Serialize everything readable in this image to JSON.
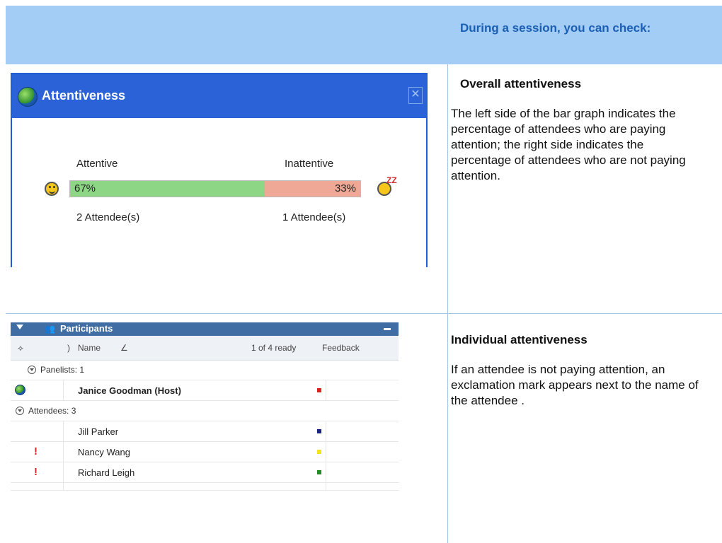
{
  "header": {
    "text": "During a session, you can check:"
  },
  "attentiveness_window": {
    "title": "Attentive­ness",
    "labels": {
      "attentive": "Attentive",
      "inattentive": "Inattentive"
    },
    "attentive_pct_text": "67%",
    "inattentive_pct_text": "33%",
    "attentive_fraction": 0.67,
    "attendees_attentive": "2 Attendee(s)",
    "attendees_inattentive": "1 Attendee(s)"
  },
  "overall": {
    "title": "Overall attentiveness",
    "body": "The left side of the bar graph indicates the percentage of attendees who are paying attention; the right side indicates the percentage of attendees who are not paying attention."
  },
  "participants_panel": {
    "title": "Participants",
    "columns": {
      "name": "Name",
      "ready": "1 of 4 ready",
      "feedback": "Feedback"
    },
    "groups": {
      "panelists": "Panelists: 1",
      "attendees": "Attendees: 3"
    },
    "host": {
      "name": "Janice Goodman (Host)",
      "color": "#e02020"
    },
    "attendees": [
      {
        "name": "Jill Parker",
        "color": "#1a237e",
        "inattentive": false
      },
      {
        "name": "Nancy Wang",
        "color": "#f3e31b",
        "inattentive": true
      },
      {
        "name": "Richard Leigh",
        "color": "#1e8a2a",
        "inattentive": true
      }
    ],
    "exclamation": "!"
  },
  "individual": {
    "title": "Individual attentiveness",
    "body": "If an attendee  is not paying attention, an exclamation mark appears next to the name of the attendee ."
  }
}
